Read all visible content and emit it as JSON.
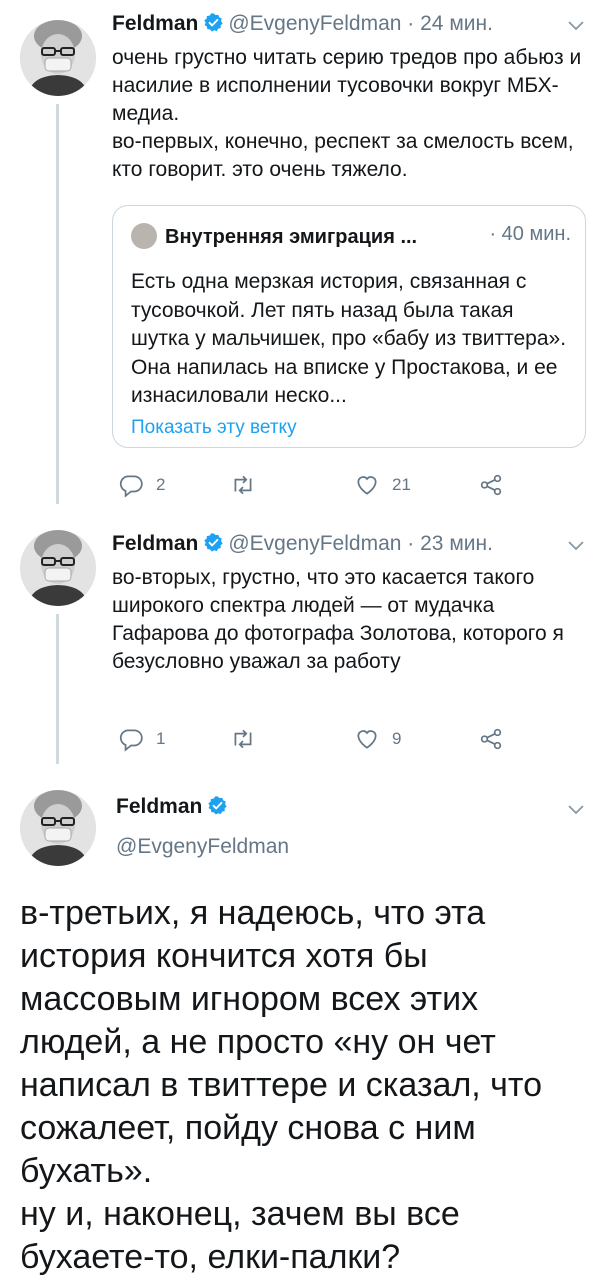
{
  "colors": {
    "link": "#1da1f2",
    "verified": "#1da1f2",
    "muted": "#657786",
    "border": "#ccd6dd"
  },
  "tweet1": {
    "name": "Feldman",
    "handle": "@EvgenyFeldman",
    "separator": "·",
    "time": "24 мин.",
    "text": "очень грустно читать серию тредов про абьюз и насилие в исполнении тусовочки вокруг МБХ-медиа.\nво-первых, конечно, респект за смелость всем, кто говорит. это очень тяжело.",
    "quote": {
      "name": "Внутренняя эмиграция ...",
      "time": "· 40 мин.",
      "text": "Есть одна мерзкая история, связанная с тусовочкой. Лет пять назад была такая шутка у мальчишек, про «бабу из твиттера». Она напилась на вписке у Простакова, и ее изнасиловали неско...",
      "link": "Показать эту ветку"
    },
    "replies": "2",
    "likes": "21"
  },
  "tweet2": {
    "name": "Feldman",
    "handle": "@EvgenyFeldman",
    "separator": "·",
    "time": "23 мин.",
    "text": "во-вторых, грустно, что это касается такого широкого спектра людей — от мудачка Гафарова до фотографа Золотова, которого я безусловно уважал за работу",
    "replies": "1",
    "likes": "9"
  },
  "tweet3": {
    "name": "Feldman",
    "handle": "@EvgenyFeldman",
    "text": "в-третьих, я надеюсь, что эта история кончится хотя бы массовым игнором всех этих людей, а не просто «ну он чет написал в твиттере и сказал, что сожалеет, пойду снова с ним бухать».\nну и, наконец, зачем вы все бухаете-то, елки-палки?"
  },
  "icons": [
    "verified-icon",
    "chevron-down-icon",
    "reply-icon",
    "retweet-icon",
    "like-icon",
    "share-icon"
  ]
}
